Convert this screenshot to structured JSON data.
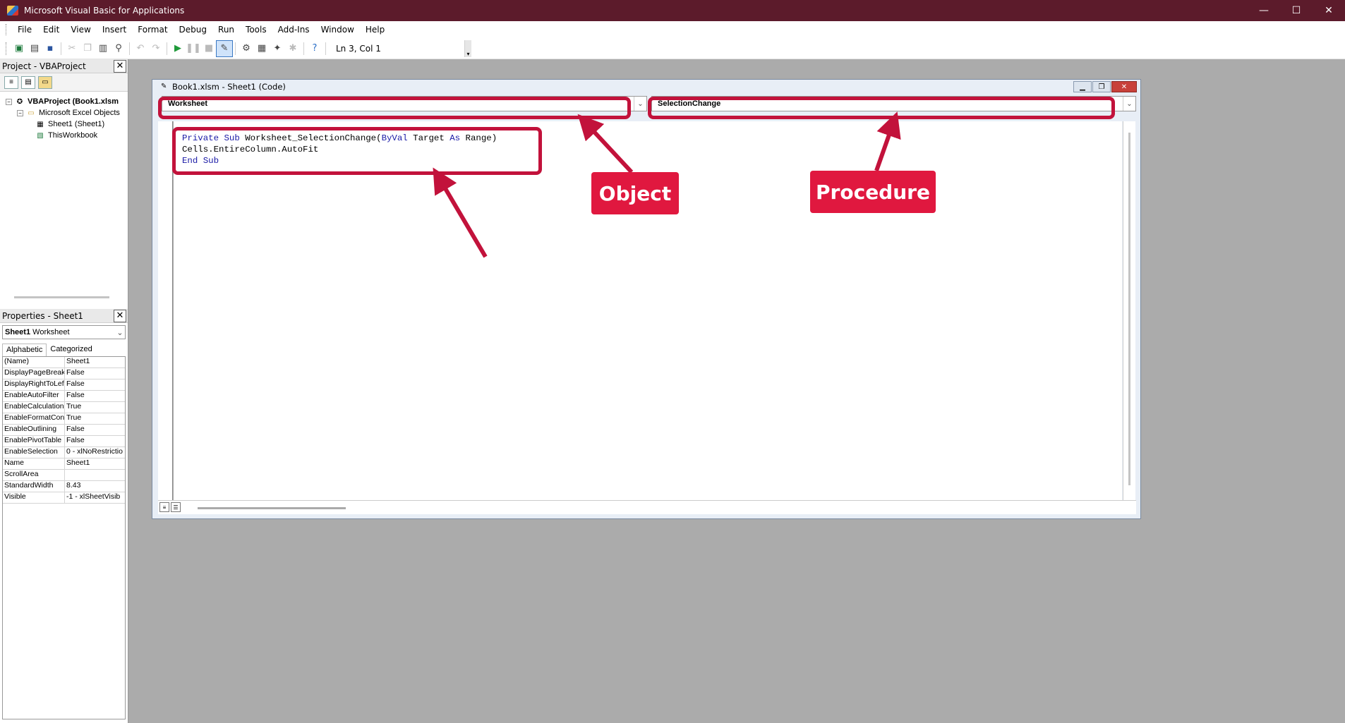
{
  "window": {
    "title": "Microsoft Visual Basic for Applications",
    "controls": [
      "—",
      "☐",
      "✕"
    ]
  },
  "menu": {
    "items": [
      {
        "label": "File",
        "key": "F"
      },
      {
        "label": "Edit",
        "key": "E"
      },
      {
        "label": "View",
        "key": "V"
      },
      {
        "label": "Insert",
        "key": "I"
      },
      {
        "label": "Format",
        "key": "o"
      },
      {
        "label": "Debug",
        "key": "D"
      },
      {
        "label": "Run",
        "key": "R"
      },
      {
        "label": "Tools",
        "key": "T"
      },
      {
        "label": "Add-Ins",
        "key": "A"
      },
      {
        "label": "Window",
        "key": "W"
      },
      {
        "label": "Help",
        "key": "H"
      }
    ]
  },
  "toolbar": {
    "status": "Ln 3, Col 1",
    "end_grip": "▾"
  },
  "project": {
    "header": "Project - VBAProject",
    "close": "✕",
    "tree": {
      "root": "VBAProject (Book1.xlsm",
      "folder": "Microsoft Excel Objects",
      "sheet": "Sheet1 (Sheet1)",
      "workbook": "ThisWorkbook"
    }
  },
  "properties": {
    "header": "Properties - Sheet1",
    "close": "✕",
    "object_name": "Sheet1",
    "object_type": "Worksheet",
    "tabs": [
      "Alphabetic",
      "Categorized"
    ],
    "rows": [
      {
        "name": "(Name)",
        "value": "Sheet1"
      },
      {
        "name": "DisplayPageBreak",
        "value": "False"
      },
      {
        "name": "DisplayRightToLef",
        "value": "False"
      },
      {
        "name": "EnableAutoFilter",
        "value": "False"
      },
      {
        "name": "EnableCalculation",
        "value": "True"
      },
      {
        "name": "EnableFormatCon",
        "value": "True"
      },
      {
        "name": "EnableOutlining",
        "value": "False"
      },
      {
        "name": "EnablePivotTable",
        "value": "False"
      },
      {
        "name": "EnableSelection",
        "value": "0 - xlNoRestrictio"
      },
      {
        "name": "Name",
        "value": "Sheet1"
      },
      {
        "name": "ScrollArea",
        "value": ""
      },
      {
        "name": "StandardWidth",
        "value": "8.43"
      },
      {
        "name": "Visible",
        "value": "-1 - xlSheetVisib"
      }
    ]
  },
  "code_window": {
    "title": "Book1.xlsm - Sheet1 (Code)",
    "object_combo": "Worksheet",
    "procedure_combo": "SelectionChange",
    "code": {
      "line1_kw1": "Private Sub",
      "line1_name": " Worksheet_SelectionChange(",
      "line1_kw2": "ByVal",
      "line1_mid": " Target ",
      "line1_kw3": "As",
      "line1_end": " Range)",
      "line2": "Cells.EntireColumn.AutoFit",
      "line3_kw": "End Sub"
    }
  },
  "annotations": {
    "object_label": "Object",
    "procedure_label": "Procedure",
    "color": "#e0183f"
  }
}
